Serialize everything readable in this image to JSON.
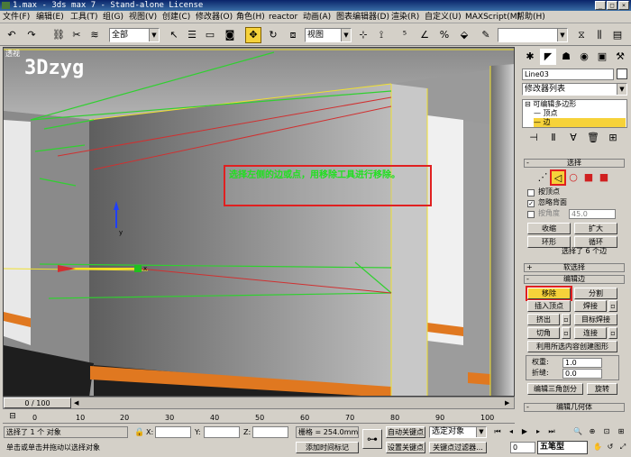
{
  "window": {
    "title": "1.max - 3ds max 7  - Stand-alone License"
  },
  "menu": [
    "文件(F)",
    "编辑(E)",
    "工具(T)",
    "组(G)",
    "视图(V)",
    "创建(C)",
    "修改器(O)",
    "角色(H)",
    "reactor",
    "动画(A)",
    "图表编辑器(D)",
    "渲染(R)",
    "自定义(U)",
    "MAXScript(M)",
    "帮助(H)"
  ],
  "toolbar": {
    "selection_filter": "全部",
    "ref_coord": "视图"
  },
  "viewport": {
    "label": "透视",
    "watermark": "3Dzyg",
    "annotation": "选择左侧的边或点，用移除工具进行移除。",
    "axis_y": "y",
    "axis_x": "x"
  },
  "panel": {
    "object_name": "Line03",
    "modifier_list": "修改器列表",
    "stack": [
      "可编辑多边形",
      "顶点",
      "边"
    ],
    "selection": {
      "title": "选择",
      "by_vertex": "按顶点",
      "ignore_backfacing": "忽略背面",
      "by_angle": "按角度",
      "angle_value": "45.0",
      "shrink": "收缩",
      "grow": "扩大",
      "ring": "环形",
      "loop": "循环",
      "status": "选择了 6 个边"
    },
    "soft_selection": "软选择",
    "edit_edges": {
      "title": "编辑边",
      "remove": "移除",
      "split": "分割",
      "insert_vertex": "插入顶点",
      "weld": "焊接",
      "extrude": "挤出",
      "target_weld": "目标焊接",
      "chamfer": "切角",
      "bridge": "连接",
      "create_shape": "利用所选内容创建图形",
      "weight_label": "权重:",
      "weight_value": "1.0",
      "crease_label": "折缝:",
      "crease_value": "0.0",
      "edit_tri": "编辑三角剖分",
      "turn": "旋转"
    },
    "edit_geometry": "编辑几何体"
  },
  "timeline": {
    "frame": "0 / 100",
    "ticks": [
      "0",
      "10",
      "20",
      "30",
      "40",
      "50",
      "60",
      "70",
      "80",
      "90",
      "100"
    ]
  },
  "status": {
    "selected": "选择了 1 个 对象",
    "prompt": "单击或单击并拖动以选择对象",
    "x_label": "X:",
    "y_label": "Y:",
    "z_label": "Z:",
    "grid": "栅格 = 254.0mm",
    "add_time_tag": "添加时间标记",
    "auto_key": "自动关键点",
    "set_key": "设置关键点",
    "selected_set": "选定对象",
    "key_filters": "关键点过滤器...",
    "frame_field": "0",
    "brand": "五笔型"
  }
}
